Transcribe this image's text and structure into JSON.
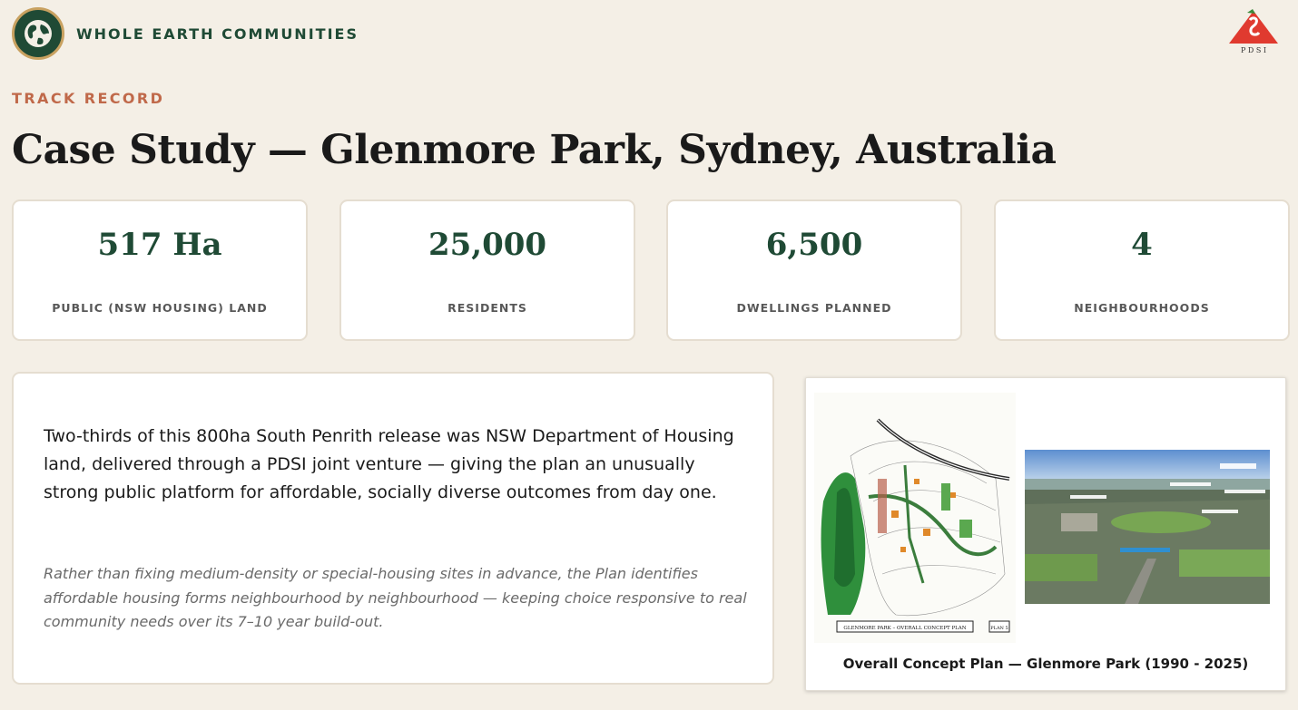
{
  "brand": {
    "name": "WHOLE EARTH COMMUNITIES",
    "logo_icon": "globe-icon",
    "partner_logo": "pdsi-logo",
    "partner_letters": "P D S I"
  },
  "section": {
    "eyebrow": "TRACK RECORD",
    "title": "Case Study — Glenmore Park, Sydney, Australia"
  },
  "stats": [
    {
      "value": "517 Ha",
      "label": "PUBLIC (NSW HOUSING) LAND"
    },
    {
      "value": "25,000",
      "label": "RESIDENTS"
    },
    {
      "value": "6,500",
      "label": "DWELLINGS PLANNED"
    },
    {
      "value": "4",
      "label": "NEIGHBOURHOODS"
    }
  ],
  "body": {
    "lead": "Two-thirds of this 800ha South Penrith release was NSW Department of Housing land, delivered through a PDSI joint venture — giving the plan an unusually strong public platform for affordable, socially diverse outcomes from day one.",
    "note": "Rather than fixing medium-density or special-housing sites in advance, the Plan identifies affordable housing forms neighbourhood by neighbourhood — keeping choice responsive to real community needs over its 7–10 year build-out."
  },
  "figure": {
    "plan_title": "GLENMORE PARK – OVERALL CONCEPT PLAN",
    "plan_number": "PLAN 5",
    "caption": "Overall Concept Plan — Glenmore Park (1990 - 2025)"
  },
  "colors": {
    "background": "#f4efe6",
    "brand_green": "#1f4a35",
    "accent": "#c0694a",
    "gold": "#c8a160",
    "pdsi_red": "#e03a2f"
  }
}
